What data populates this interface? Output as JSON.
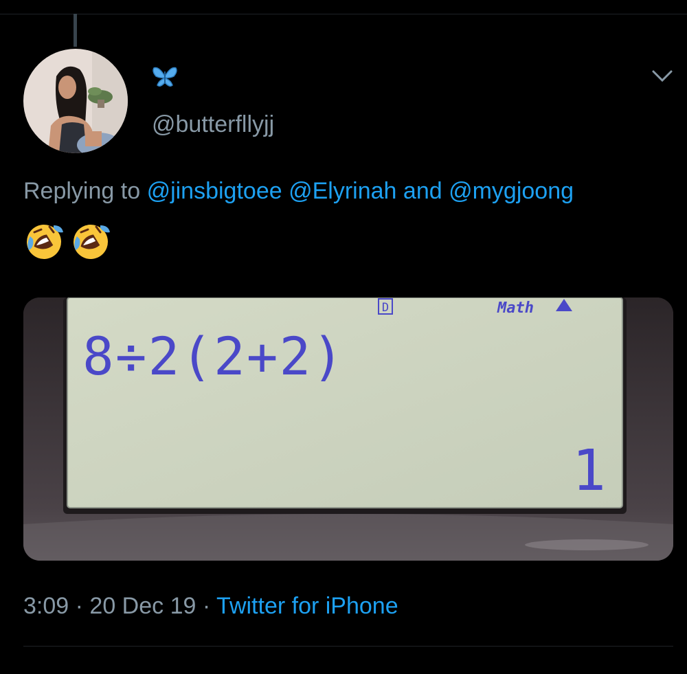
{
  "tweet": {
    "display_name_icon": "butterfly-icon",
    "handle": "@butterfllyjj",
    "replying_prefix": "Replying to",
    "mention_1": "@jinsbigtoee",
    "mention_2": "@Elyrinah",
    "and_word": "and",
    "mention_3": "@mygjoong",
    "emoji_text": "🤣🤣",
    "time": "3:09",
    "sep1": "·",
    "date": "20 Dec 19",
    "sep2": "·",
    "source": "Twitter for iPhone"
  },
  "calculator": {
    "indicator_d": "D",
    "mode": "Math",
    "expression": "8÷2(2+2)",
    "result": "1"
  },
  "colors": {
    "link": "#1da1f2",
    "secondary_text": "#8899a6",
    "lcd_background": "#cfd6c0",
    "lcd_digits": "#4a48c8"
  }
}
